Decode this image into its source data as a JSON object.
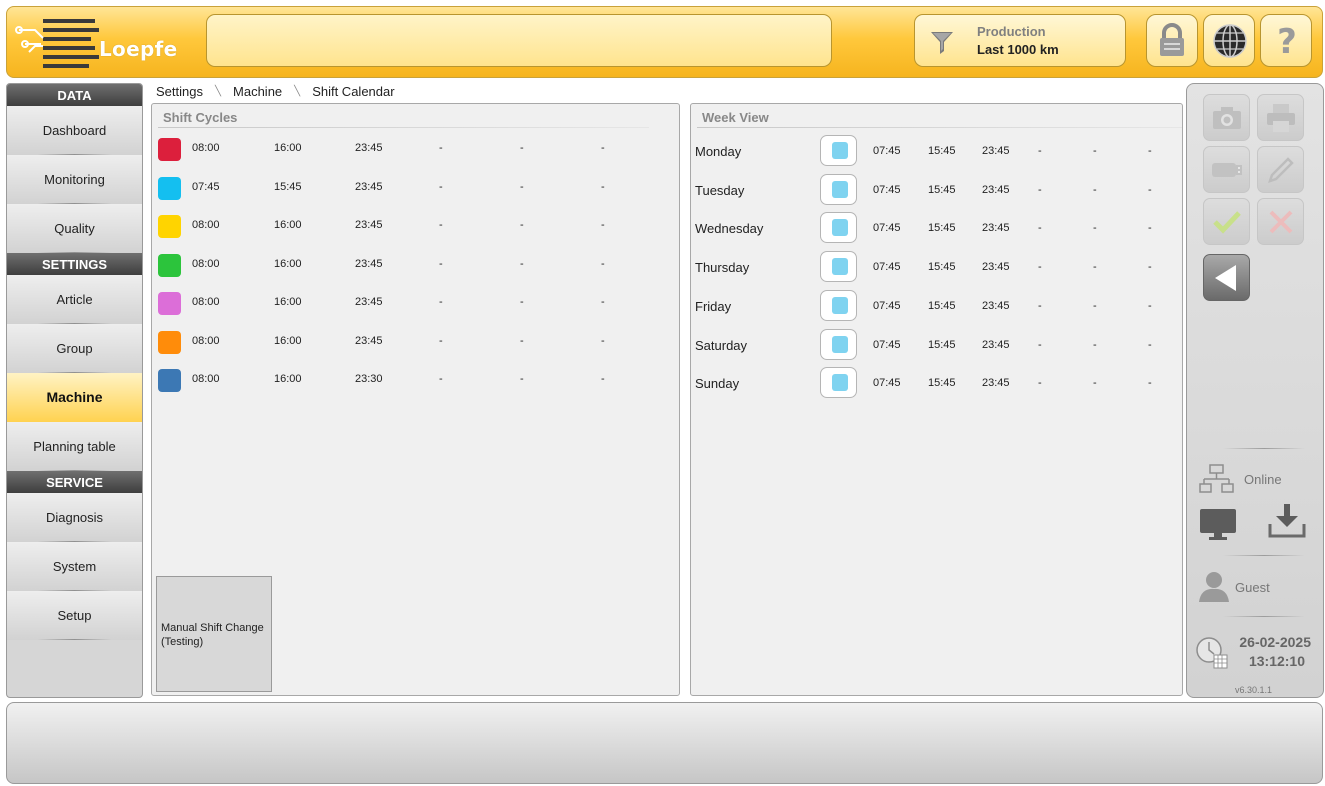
{
  "header": {
    "logo_text": "Loepfe",
    "filter_title": "Production",
    "filter_value": "Last 1000 km",
    "icons": [
      "funnel-icon",
      "lock-icon",
      "globe-icon",
      "help-icon"
    ]
  },
  "nav": {
    "sections": [
      {
        "title": "DATA",
        "items": [
          "Dashboard",
          "Monitoring",
          "Quality"
        ]
      },
      {
        "title": "SETTINGS",
        "items": [
          "Article",
          "Group",
          "Machine",
          "Planning table"
        ]
      },
      {
        "title": "SERVICE",
        "items": [
          "Diagnosis",
          "System",
          "Setup"
        ]
      }
    ],
    "active": "Machine"
  },
  "breadcrumb": [
    "Settings",
    "Machine",
    "Shift Calendar"
  ],
  "shift_cycles": {
    "title": "Shift Cycles",
    "rows": [
      {
        "color": "#dc1f3c",
        "times": [
          "08:00",
          "16:00",
          "23:45",
          "-",
          "-",
          "-"
        ]
      },
      {
        "color": "#14bff0",
        "times": [
          "07:45",
          "15:45",
          "23:45",
          "-",
          "-",
          "-"
        ]
      },
      {
        "color": "#ffd400",
        "times": [
          "08:00",
          "16:00",
          "23:45",
          "-",
          "-",
          "-"
        ]
      },
      {
        "color": "#2cc43c",
        "times": [
          "08:00",
          "16:00",
          "23:45",
          "-",
          "-",
          "-"
        ]
      },
      {
        "color": "#dc6ed8",
        "times": [
          "08:00",
          "16:00",
          "23:45",
          "-",
          "-",
          "-"
        ]
      },
      {
        "color": "#ff8c0a",
        "times": [
          "08:00",
          "16:00",
          "23:45",
          "-",
          "-",
          "-"
        ]
      },
      {
        "color": "#3c78b4",
        "times": [
          "08:00",
          "16:00",
          "23:30",
          "-",
          "-",
          "-"
        ]
      }
    ],
    "manual_button_line1": "Manual Shift Change",
    "manual_button_line2": "(Testing)"
  },
  "week_view": {
    "title": "Week View",
    "rows": [
      {
        "day": "Monday",
        "times": [
          "07:45",
          "15:45",
          "23:45",
          "-",
          "-",
          "-"
        ]
      },
      {
        "day": "Tuesday",
        "times": [
          "07:45",
          "15:45",
          "23:45",
          "-",
          "-",
          "-"
        ]
      },
      {
        "day": "Wednesday",
        "times": [
          "07:45",
          "15:45",
          "23:45",
          "-",
          "-",
          "-"
        ]
      },
      {
        "day": "Thursday",
        "times": [
          "07:45",
          "15:45",
          "23:45",
          "-",
          "-",
          "-"
        ]
      },
      {
        "day": "Friday",
        "times": [
          "07:45",
          "15:45",
          "23:45",
          "-",
          "-",
          "-"
        ]
      },
      {
        "day": "Saturday",
        "times": [
          "07:45",
          "15:45",
          "23:45",
          "-",
          "-",
          "-"
        ]
      },
      {
        "day": "Sunday",
        "times": [
          "07:45",
          "15:45",
          "23:45",
          "-",
          "-",
          "-"
        ]
      }
    ]
  },
  "right_bar": {
    "status": "Online",
    "user": "Guest",
    "date": "26-02-2025",
    "time": "13:12:10",
    "version": "v6.30.1.1"
  }
}
